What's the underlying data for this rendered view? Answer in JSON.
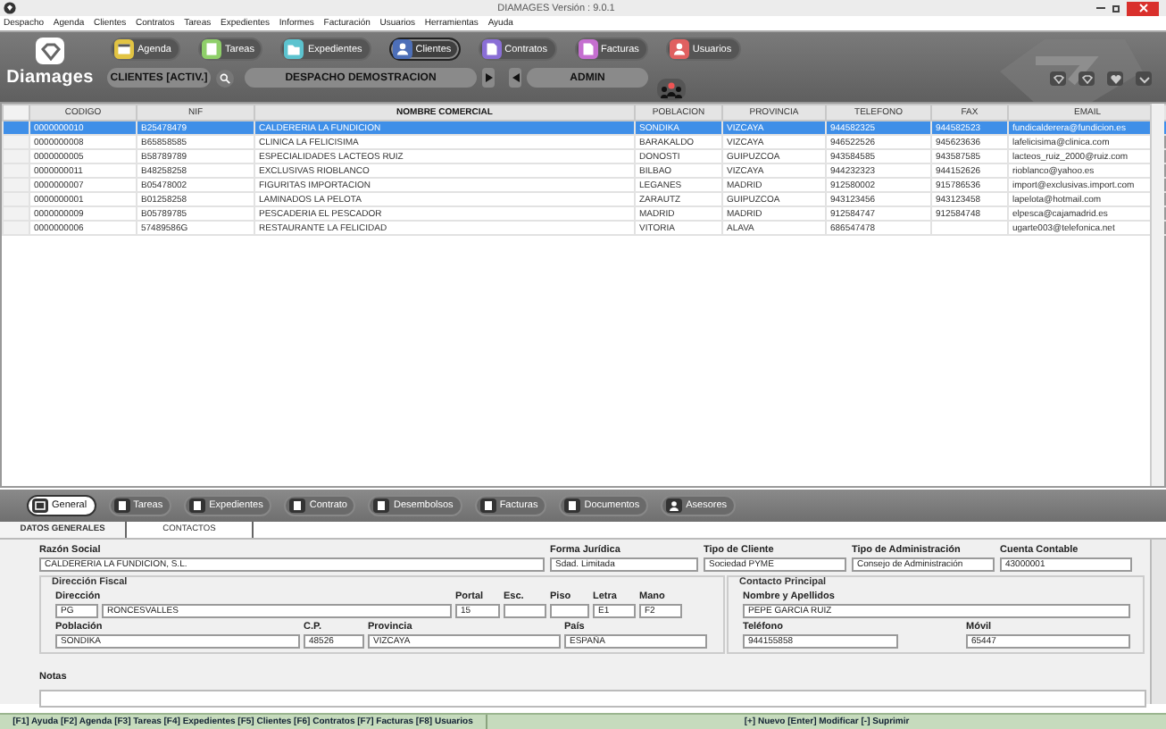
{
  "window": {
    "title": "DIAMAGES  Versión : 9.0.1"
  },
  "menu": [
    "Despacho",
    "Agenda",
    "Clientes",
    "Contratos",
    "Tareas",
    "Expedientes",
    "Informes",
    "Facturación",
    "Usuarios",
    "Herramientas",
    "Ayuda"
  ],
  "app_name": "Diamages",
  "modules": [
    {
      "label": "Agenda",
      "color": "#e2c443",
      "selected": false
    },
    {
      "label": "Tareas",
      "color": "#8fcf6a",
      "selected": false
    },
    {
      "label": "Expedientes",
      "color": "#5cc3cf",
      "selected": false
    },
    {
      "label": "Clientes",
      "color": "#4d6fb8",
      "selected": true
    },
    {
      "label": "Contratos",
      "color": "#8a6fd6",
      "selected": false
    },
    {
      "label": "Facturas",
      "color": "#c56fd0",
      "selected": false
    },
    {
      "label": "Usuarios",
      "color": "#e06060",
      "selected": false
    }
  ],
  "context": {
    "list": "CLIENTES [ACTIV.]",
    "office": "DESPACHO DEMOSTRACION",
    "user": "ADMIN"
  },
  "table": {
    "columns": [
      "CODIGO",
      "NIF",
      "NOMBRE COMERCIAL",
      "POBLACION",
      "PROVINCIA",
      "TELEFONO",
      "FAX",
      "EMAIL"
    ],
    "rows": [
      {
        "selected": true,
        "cells": [
          "0000000010",
          "B25478479",
          "CALDERERIA LA FUNDICION",
          "SONDIKA",
          "VIZCAYA",
          "944582325",
          "944582523",
          "fundicalderera@fundicion.es"
        ]
      },
      {
        "selected": false,
        "cells": [
          "0000000008",
          "B65858585",
          "CLINICA LA FELICISIMA",
          "BARAKALDO",
          "VIZCAYA",
          "946522526",
          "945623636",
          "lafelicisima@clinica.com"
        ]
      },
      {
        "selected": false,
        "cells": [
          "0000000005",
          "B58789789",
          "ESPECIALIDADES LACTEOS RUIZ",
          "DONOSTI",
          "GUIPUZCOA",
          "943584585",
          "943587585",
          "lacteos_ruiz_2000@ruiz.com"
        ]
      },
      {
        "selected": false,
        "cells": [
          "0000000011",
          "B48258258",
          "EXCLUSIVAS RIOBLANCO",
          "BILBAO",
          "VIZCAYA",
          "944232323",
          "944152626",
          "rioblanco@yahoo.es"
        ]
      },
      {
        "selected": false,
        "cells": [
          "0000000007",
          "B05478002",
          "FIGURITAS IMPORTACION",
          "LEGANES",
          "MADRID",
          "912580002",
          "915786536",
          "import@exclusivas.import.com"
        ]
      },
      {
        "selected": false,
        "cells": [
          "0000000001",
          "B01258258",
          "LAMINADOS LA PELOTA",
          "ZARAUTZ",
          "GUIPUZCOA",
          "943123456",
          "943123458",
          "lapelota@hotmail.com"
        ]
      },
      {
        "selected": false,
        "cells": [
          "0000000009",
          "B05789785",
          "PESCADERIA EL PESCADOR",
          "MADRID",
          "MADRID",
          "912584747",
          "912584748",
          "elpesca@cajamadrid.es"
        ]
      },
      {
        "selected": false,
        "cells": [
          "0000000006",
          "57489586G",
          "RESTAURANTE LA FELICIDAD",
          "VITORIA",
          "ALAVA",
          "686547478",
          null,
          "ugarte003@telefonica.net"
        ]
      }
    ]
  },
  "detail_tabs": [
    {
      "label": "General",
      "selected": true
    },
    {
      "label": "Tareas",
      "selected": false
    },
    {
      "label": "Expedientes",
      "selected": false
    },
    {
      "label": "Contrato",
      "selected": false
    },
    {
      "label": "Desembolsos",
      "selected": false
    },
    {
      "label": "Facturas",
      "selected": false
    },
    {
      "label": "Documentos",
      "selected": false
    },
    {
      "label": "Asesores",
      "selected": false
    }
  ],
  "sub_tabs": [
    {
      "label": "DATOS GENERALES",
      "selected": true
    },
    {
      "label": "CONTACTOS",
      "selected": false
    }
  ],
  "form": {
    "top": [
      {
        "label": "Razón Social",
        "value": "CALDERERIA LA FUNDICION, S.L."
      },
      {
        "label": "Forma Jurídica",
        "value": "Sdad. Limitada"
      },
      {
        "label": "Tipo de Cliente",
        "value": "Sociedad PYME"
      },
      {
        "label": "Tipo de Administración",
        "value": "Consejo de Administración"
      },
      {
        "label": "Cuenta Contable",
        "value": "43000001"
      }
    ],
    "fiscal": {
      "title": "Dirección Fiscal",
      "rows": [
        [
          {
            "label": "Dirección",
            "values": [
              "PG",
              "RONCESVALLES"
            ]
          },
          {
            "label": "Portal",
            "values": [
              "15"
            ]
          },
          {
            "label": "Esc."
          },
          {
            "label": "Piso"
          },
          {
            "label": "Letra",
            "values": [
              "E1"
            ]
          },
          {
            "label": "Mano",
            "values": [
              "F2"
            ]
          }
        ],
        [
          {
            "label": "Población",
            "values": [
              "SONDIKA"
            ]
          },
          {
            "label": "C.P.",
            "values": [
              "48526"
            ]
          },
          {
            "label": "Provincia",
            "values": [
              "VIZCAYA"
            ]
          },
          {
            "label": "País",
            "values": [
              "ESPAÑA"
            ]
          }
        ]
      ]
    },
    "contact": {
      "title": "Contacto Principal",
      "rows": [
        [
          {
            "label": "Nombre y Apellidos",
            "values": [
              "PEPE GARCIA RUIZ"
            ]
          }
        ],
        [
          {
            "label": "Teléfono",
            "values": [
              "944155858"
            ]
          },
          {
            "label": "Móvil",
            "values": [
              "65447"
            ]
          }
        ]
      ]
    },
    "notes": {
      "label": "Notas"
    }
  },
  "status_bar": {
    "left": "[F1] Ayuda [F2] Agenda [F3] Tareas [F4] Expedientes [F5] Clientes [F6] Contratos [F7] Facturas [F8] Usuarios",
    "right": "[+] Nuevo [Enter] Modificar [-] Suprimir"
  }
}
